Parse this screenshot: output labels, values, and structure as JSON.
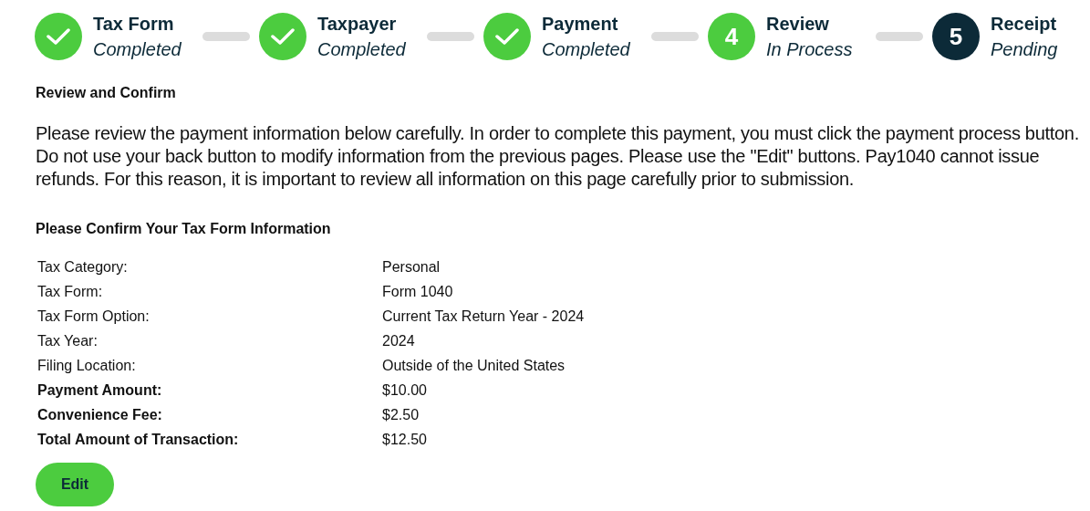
{
  "steps": [
    {
      "title": "Tax Form",
      "status_text": "Completed",
      "completed": true,
      "active": true
    },
    {
      "title": "Taxpayer",
      "status_text": "Completed",
      "completed": true,
      "active": true
    },
    {
      "title": "Payment",
      "status_text": "Completed",
      "completed": true,
      "active": true
    },
    {
      "title": "Review",
      "status_text": "In Process",
      "completed": false,
      "active": true,
      "number": "4"
    },
    {
      "title": "Receipt",
      "status_text": "Pending",
      "completed": false,
      "active": false,
      "number": "5"
    }
  ],
  "heading": "Review and Confirm",
  "intro": "Please review the payment information below carefully. In order to complete this payment, you must click the payment process button. Do not use your back button to modify information from the previous pages. Please use the \"Edit\" buttons. Pay1040 cannot issue refunds. For this reason, it is important to review all information on this page carefully prior to submission.",
  "section_title": "Please Confirm Your Tax Form Information",
  "fields": [
    {
      "label": "Tax Category:",
      "value": "Personal",
      "bold": false
    },
    {
      "label": "Tax Form:",
      "value": "Form 1040",
      "bold": false
    },
    {
      "label": "Tax Form Option:",
      "value": "Current Tax Return Year - 2024",
      "bold": false
    },
    {
      "label": "Tax Year:",
      "value": "2024",
      "bold": false
    },
    {
      "label": "Filing Location:",
      "value": "Outside of the United States",
      "bold": false
    },
    {
      "label": "Payment Amount:",
      "value": "$10.00",
      "bold": true
    },
    {
      "label": "Convenience Fee:",
      "value": "$2.50",
      "bold": true
    },
    {
      "label": "Total Amount of Transaction:",
      "value": "$12.50",
      "bold": true
    }
  ],
  "edit_button": "Edit"
}
